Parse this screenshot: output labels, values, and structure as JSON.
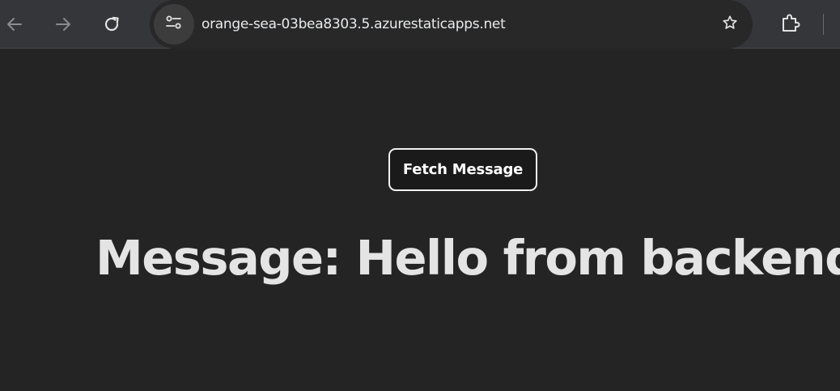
{
  "browser": {
    "url": "orange-sea-03bea8303.5.azurestaticapps.net",
    "icons": {
      "back": "arrow-left-icon",
      "forward": "arrow-right-icon",
      "reload": "reload-icon",
      "site_info": "tune-icon",
      "bookmark": "star-icon",
      "extensions": "puzzle-icon"
    }
  },
  "page": {
    "button_label": "Fetch Message",
    "message": "Message: Hello from backend!"
  },
  "colors": {
    "background": "#242424",
    "toolbar": "#35363a",
    "text": "#e4e4e4",
    "button_border": "#f2f2f2"
  }
}
